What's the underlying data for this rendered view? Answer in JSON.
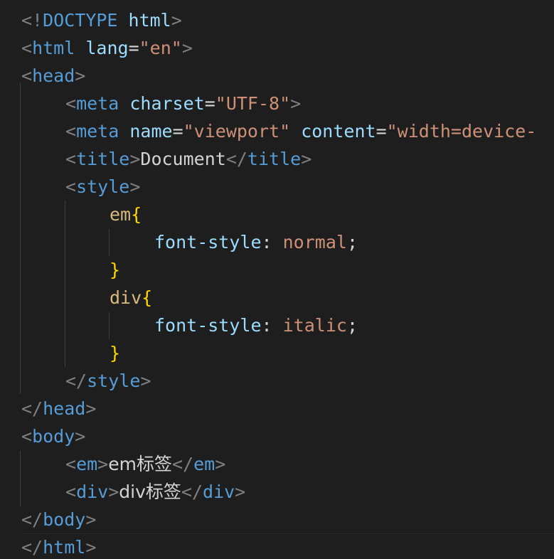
{
  "colors": {
    "background": "#1e1e1e",
    "punctuation": "#808080",
    "tag": "#569cd6",
    "attribute": "#9cdcfe",
    "string": "#ce9178",
    "text": "#d4d4d4",
    "selector": "#d7ba7d",
    "brace": "#ffd700"
  },
  "lines": [
    {
      "tokens": [
        {
          "t": "<!",
          "c": "punc"
        },
        {
          "t": "DOCTYPE",
          "c": "tag"
        },
        {
          "t": " ",
          "c": "text"
        },
        {
          "t": "html",
          "c": "attr"
        },
        {
          "t": ">",
          "c": "punc"
        }
      ]
    },
    {
      "tokens": [
        {
          "t": "<",
          "c": "punc"
        },
        {
          "t": "html",
          "c": "tag"
        },
        {
          "t": " ",
          "c": "text"
        },
        {
          "t": "lang",
          "c": "attr"
        },
        {
          "t": "=",
          "c": "text"
        },
        {
          "t": "\"en\"",
          "c": "str"
        },
        {
          "t": ">",
          "c": "punc"
        }
      ]
    },
    {
      "tokens": [
        {
          "t": "<",
          "c": "punc"
        },
        {
          "t": "head",
          "c": "tag"
        },
        {
          "t": ">",
          "c": "punc"
        }
      ]
    },
    {
      "tokens": [
        {
          "t": "<",
          "c": "punc"
        },
        {
          "t": "meta",
          "c": "tag"
        },
        {
          "t": " ",
          "c": "text"
        },
        {
          "t": "charset",
          "c": "attr"
        },
        {
          "t": "=",
          "c": "text"
        },
        {
          "t": "\"UTF-8\"",
          "c": "str"
        },
        {
          "t": ">",
          "c": "punc"
        }
      ]
    },
    {
      "tokens": [
        {
          "t": "<",
          "c": "punc"
        },
        {
          "t": "meta",
          "c": "tag"
        },
        {
          "t": " ",
          "c": "text"
        },
        {
          "t": "name",
          "c": "attr"
        },
        {
          "t": "=",
          "c": "text"
        },
        {
          "t": "\"viewport\"",
          "c": "str"
        },
        {
          "t": " ",
          "c": "text"
        },
        {
          "t": "content",
          "c": "attr"
        },
        {
          "t": "=",
          "c": "text"
        },
        {
          "t": "\"width=device-",
          "c": "str"
        }
      ]
    },
    {
      "tokens": [
        {
          "t": "<",
          "c": "punc"
        },
        {
          "t": "title",
          "c": "tag"
        },
        {
          "t": ">",
          "c": "punc"
        },
        {
          "t": "Document",
          "c": "text"
        },
        {
          "t": "</",
          "c": "punc"
        },
        {
          "t": "title",
          "c": "tag"
        },
        {
          "t": ">",
          "c": "punc"
        }
      ]
    },
    {
      "tokens": [
        {
          "t": "<",
          "c": "punc"
        },
        {
          "t": "style",
          "c": "tag"
        },
        {
          "t": ">",
          "c": "punc"
        }
      ]
    },
    {
      "tokens": [
        {
          "t": "em",
          "c": "sel"
        },
        {
          "t": "{",
          "c": "brace"
        }
      ]
    },
    {
      "tokens": [
        {
          "t": "font-style",
          "c": "prop"
        },
        {
          "t": ": ",
          "c": "text"
        },
        {
          "t": "normal",
          "c": "str"
        },
        {
          "t": ";",
          "c": "text"
        }
      ]
    },
    {
      "tokens": [
        {
          "t": "}",
          "c": "brace"
        }
      ]
    },
    {
      "tokens": [
        {
          "t": "div",
          "c": "sel"
        },
        {
          "t": "{",
          "c": "brace"
        }
      ]
    },
    {
      "tokens": [
        {
          "t": "font-style",
          "c": "prop"
        },
        {
          "t": ": ",
          "c": "text"
        },
        {
          "t": "italic",
          "c": "str"
        },
        {
          "t": ";",
          "c": "text"
        }
      ]
    },
    {
      "tokens": [
        {
          "t": "}",
          "c": "brace"
        }
      ]
    },
    {
      "tokens": [
        {
          "t": "</",
          "c": "punc"
        },
        {
          "t": "style",
          "c": "tag"
        },
        {
          "t": ">",
          "c": "punc"
        }
      ]
    },
    {
      "tokens": [
        {
          "t": "</",
          "c": "punc"
        },
        {
          "t": "head",
          "c": "tag"
        },
        {
          "t": ">",
          "c": "punc"
        }
      ]
    },
    {
      "tokens": [
        {
          "t": "<",
          "c": "punc"
        },
        {
          "t": "body",
          "c": "tag"
        },
        {
          "t": ">",
          "c": "punc"
        }
      ]
    },
    {
      "tokens": [
        {
          "t": "<",
          "c": "punc"
        },
        {
          "t": "em",
          "c": "tag"
        },
        {
          "t": ">",
          "c": "punc"
        },
        {
          "t": "em标签",
          "c": "text"
        },
        {
          "t": "</",
          "c": "punc"
        },
        {
          "t": "em",
          "c": "tag"
        },
        {
          "t": ">",
          "c": "punc"
        }
      ]
    },
    {
      "tokens": [
        {
          "t": "<",
          "c": "punc"
        },
        {
          "t": "div",
          "c": "tag"
        },
        {
          "t": ">",
          "c": "punc"
        },
        {
          "t": "div标签",
          "c": "text"
        },
        {
          "t": "</",
          "c": "punc"
        },
        {
          "t": "div",
          "c": "tag"
        },
        {
          "t": ">",
          "c": "punc"
        }
      ]
    },
    {
      "tokens": [
        {
          "t": "</",
          "c": "punc"
        },
        {
          "t": "body",
          "c": "tag"
        },
        {
          "t": ">",
          "c": "punc"
        }
      ]
    },
    {
      "tokens": [
        {
          "t": "</",
          "c": "punc"
        },
        {
          "t": "html",
          "c": "tag"
        },
        {
          "t": ">",
          "c": "punc"
        }
      ]
    }
  ]
}
